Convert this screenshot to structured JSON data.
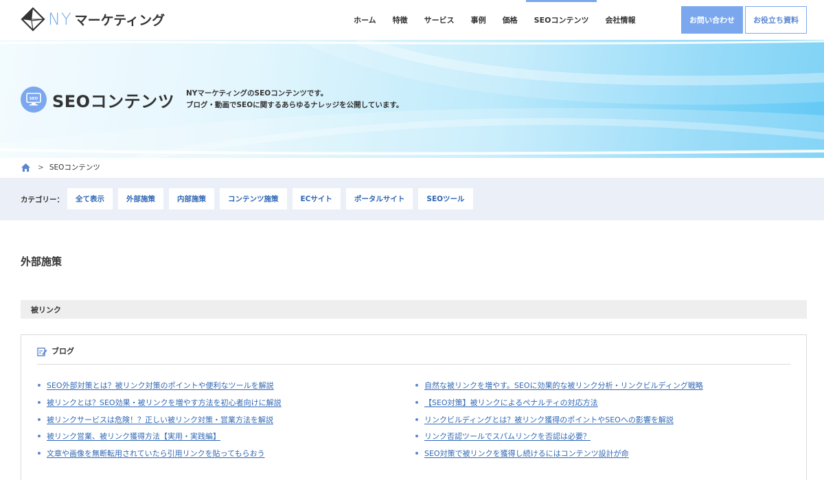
{
  "header": {
    "logo_ny": "NY",
    "logo_text": "マーケティング",
    "nav": [
      {
        "label": "ホーム"
      },
      {
        "label": "特徴"
      },
      {
        "label": "サービス"
      },
      {
        "label": "事例"
      },
      {
        "label": "価格"
      },
      {
        "label": "SEOコンテンツ",
        "active": true
      },
      {
        "label": "会社情報"
      }
    ],
    "contact_button": "お問い合わせ",
    "docs_button": "お役立ち資料"
  },
  "hero": {
    "title": "SEOコンテンツ",
    "icon": "monitor-seo-icon",
    "icon_text": "SEO",
    "description_line1": "NYマーケティングのSEOコンテンツです。",
    "description_line2": "ブログ・動画でSEOに関するあらゆるナレッジを公開しています。"
  },
  "breadcrumb": {
    "home_icon": "home-icon",
    "separator": ">",
    "current": "SEOコンテンツ"
  },
  "categories": {
    "label": "カテゴリー：",
    "items": [
      {
        "label": "全て表示"
      },
      {
        "label": "外部施策"
      },
      {
        "label": "内部施策"
      },
      {
        "label": "コンテンツ施策"
      },
      {
        "label": "ECサイト"
      },
      {
        "label": "ポータルサイト"
      },
      {
        "label": "SEOツール"
      }
    ]
  },
  "section": {
    "title": "外部施策",
    "subheading": "被リンク",
    "box_heading": "ブログ",
    "box_icon": "edit-note-icon",
    "left_links": [
      "SEO外部対策とは？被リンク対策のポイントや便利なツールを解説",
      "被リンクとは？SEO効果・被リンクを増やす方法を初心者向けに解説",
      "被リンクサービスは危険！？正しい被リンク対策・営業方法を解説",
      "被リンク営業、被リンク獲得方法【実用・実践編】",
      "文章や画像を無断転用されていたら引用リンクを貼ってもらおう"
    ],
    "right_links": [
      "自然な被リンクを増やす。SEOに効果的な被リンク分析・リンクビルディング戦略",
      "【SEO対策】被リンクによるペナルティの対応方法",
      "リンクビルディングとは？被リンク獲得のポイントやSEOへの影響を解説",
      "リンク否認ツールでスパムリンクを否認は必要？",
      "SEO対策で被リンクを獲得し続けるにはコンテンツ設計が命"
    ]
  },
  "colors": {
    "accent": "#7aa7ee",
    "link": "#2f67b5",
    "category_bar": "#ebeff8"
  }
}
